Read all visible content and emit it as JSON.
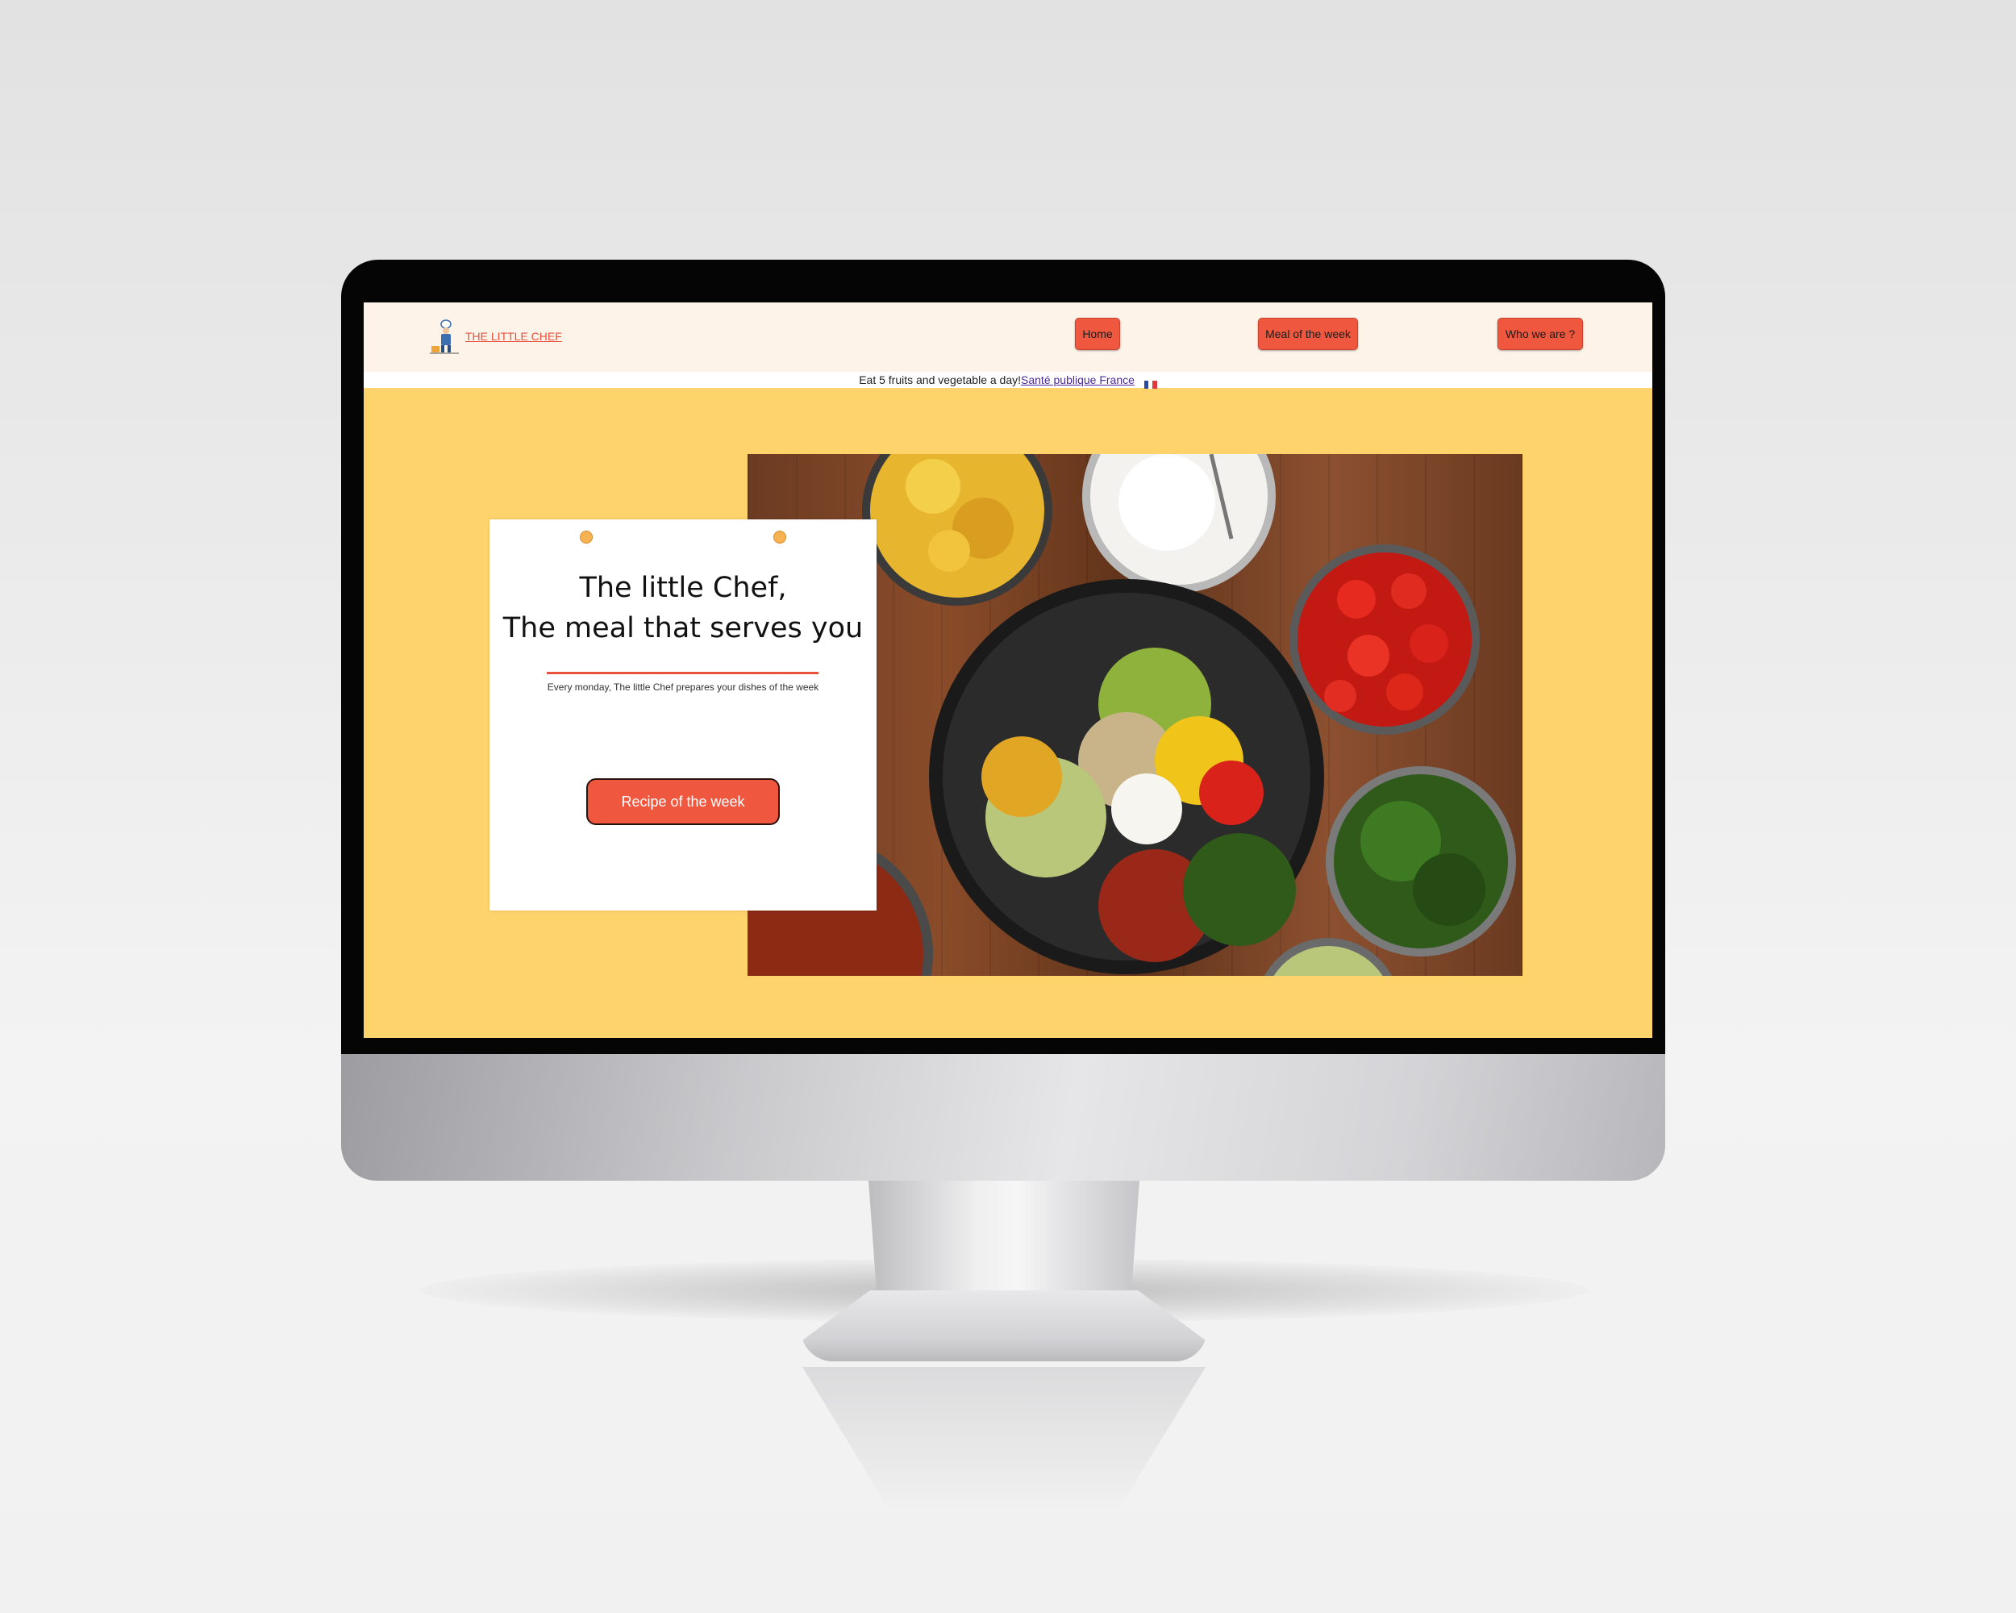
{
  "brand": {
    "name": "THE LITTLE CHEF",
    "logo_icon": "chef-icon",
    "accent_color": "#f0573f"
  },
  "nav": {
    "items": [
      {
        "label": "Home"
      },
      {
        "label": "Meal of the week"
      },
      {
        "label": "Who we are ?"
      }
    ]
  },
  "info_bar": {
    "text": "Eat 5 fruits and vegetable a day!",
    "link": "Santé publique France",
    "flag_icon": "france-flag-icon"
  },
  "hero": {
    "title_line1": "The little Chef,",
    "title_line2": "The meal that serves you",
    "subtitle": "Every monday, The little Chef prepares your dishes of the week",
    "cta_label": "Recipe of the week",
    "background_color": "#ffd36b",
    "image": "food-bowls-photo"
  }
}
